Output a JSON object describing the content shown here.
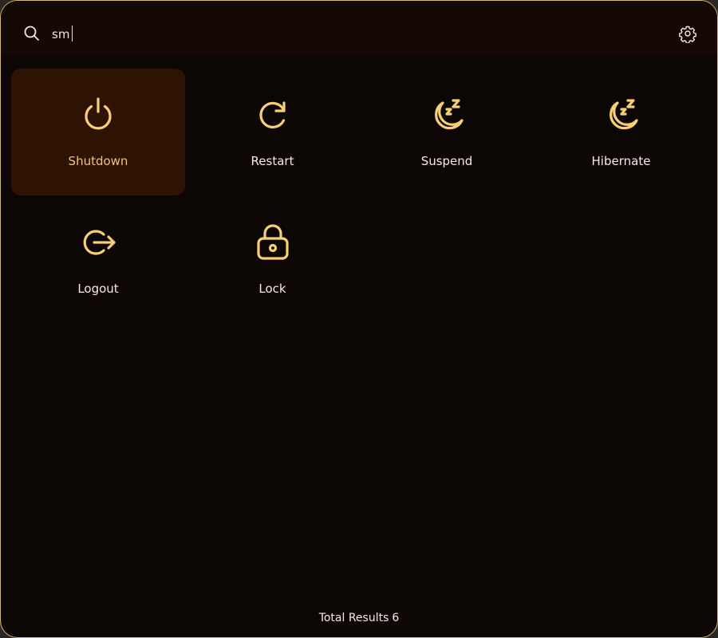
{
  "colors": {
    "accent": "#f7cf74",
    "border": "#d8b86a",
    "background": "#0c0605",
    "selected_bg": "#2e1303",
    "selected_text": "#f2c27a"
  },
  "search": {
    "icon": "search-icon",
    "value": "sm"
  },
  "settings": {
    "icon": "gear-icon"
  },
  "items": [
    {
      "label": "Shutdown",
      "icon": "power-icon",
      "selected": true
    },
    {
      "label": "Restart",
      "icon": "restart-icon",
      "selected": false
    },
    {
      "label": "Suspend",
      "icon": "moon-sleep-icon",
      "selected": false
    },
    {
      "label": "Hibernate",
      "icon": "moon-sleep-icon",
      "selected": false
    },
    {
      "label": "Logout",
      "icon": "logout-icon",
      "selected": false
    },
    {
      "label": "Lock",
      "icon": "lock-open-icon",
      "selected": false
    }
  ],
  "footer": {
    "label": "Total Results",
    "count": "6"
  }
}
